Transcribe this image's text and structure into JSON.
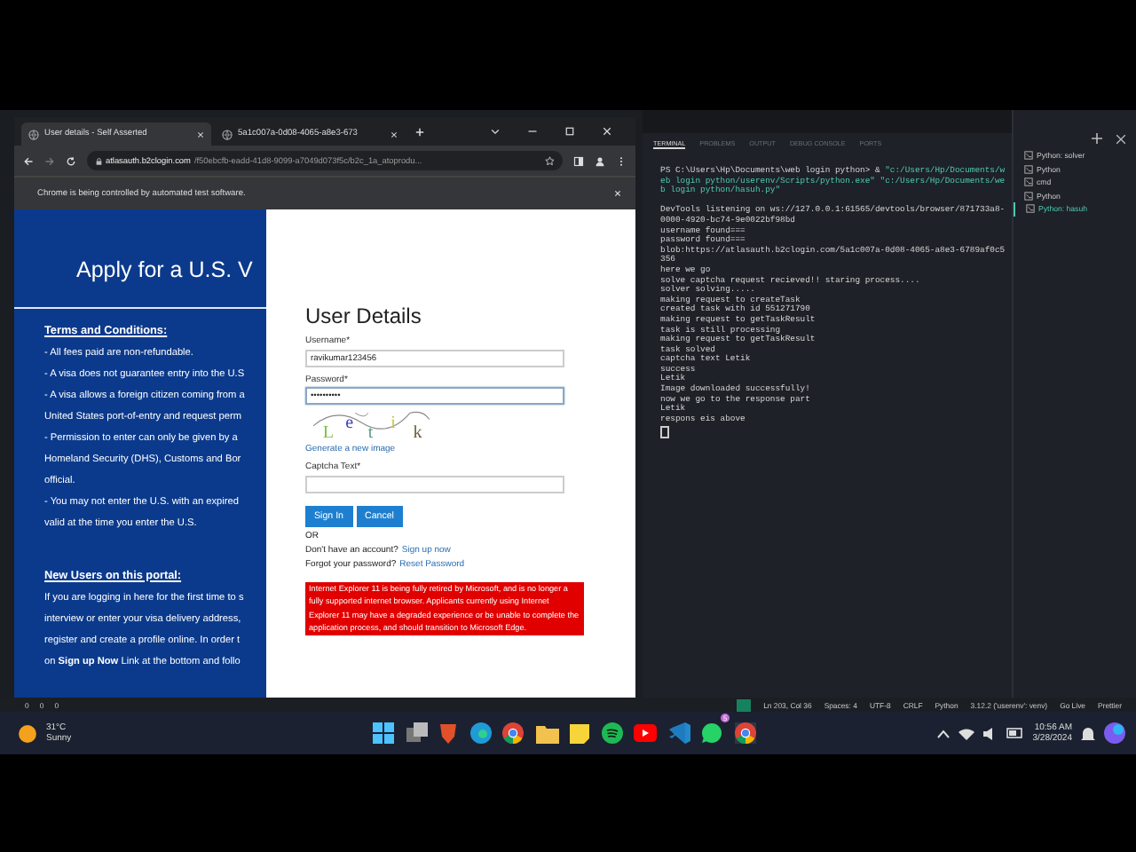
{
  "browser": {
    "tabs": [
      {
        "title": "User details - Self Asserted",
        "selected": true
      },
      {
        "title": "5a1c007a-0d08-4065-a8e3-673",
        "selected": false
      }
    ],
    "url_host": "atlasauth.b2clogin.com",
    "url_path": "/f50ebcfb-eadd-41d8-9099-a7049d073f5c/b2c_1a_atoprodu...",
    "infobar": "Chrome is being controlled by automated test software."
  },
  "page": {
    "banner_title": "Apply for a U.S. V",
    "terms_heading": "Terms and Conditions:",
    "terms_lines": [
      "- All fees paid are non-refundable.",
      "- A visa does not guarantee entry into the U.S",
      "- A visa allows a foreign citizen coming from a",
      "United States port-of-entry and request perm",
      "- Permission to enter can only be given by a",
      "Homeland Security (DHS), Customs and Bor",
      "official.",
      "- You may not enter the U.S. with an expired",
      "valid at the time you enter the U.S."
    ],
    "new_users_heading": "New Users on this portal:",
    "new_users_lines": [
      "If you are logging in here for the first time to s",
      "interview or enter your visa delivery address,",
      "register and create a profile online. In order t",
      "on **Sign up Now** Link at the bottom and follo"
    ]
  },
  "login": {
    "title": "User Details",
    "username_label": "Username*",
    "username_value": "ravikumar123456",
    "password_label": "Password*",
    "password_value": "••••••••••",
    "captcha_letters": [
      "L",
      "e",
      "t",
      "i",
      "k"
    ],
    "generate_link": "Generate a new image",
    "captcha_label": "Captcha Text*",
    "buttons": [
      "Sign In",
      "Cancel"
    ],
    "or": "OR",
    "signup_prompt": "Don't have an account?",
    "signup_link": "Sign up now",
    "forgot_prompt": "Forgot your password?",
    "reset_link": "Reset Password",
    "warning": "Internet Explorer 11 is being fully retired by Microsoft, and is no longer a fully supported internet browser. Applicants currently using Internet Explorer 11 may have a degraded experience or be unable to complete the application process, and should transition to Microsoft Edge."
  },
  "terminal": {
    "tabs": [
      {
        "label": "TERMINAL",
        "selected": true
      },
      {
        "label": "PROBLEMS",
        "selected": false
      },
      {
        "label": "OUTPUT",
        "selected": false
      },
      {
        "label": "DEBUG CONSOLE",
        "selected": false
      },
      {
        "label": "PORTS",
        "selected": false
      }
    ],
    "prompt": "PS C:\\Users\\Hp\\Documents\\web login python> & ",
    "command": "\"c:/Users/Hp/Documents/web login python/userenv/Scripts/python.exe\" \"c:/Users/Hp/Documents/web login python/hasuh.py\"",
    "lines": [
      "DevTools listening on ws://127.0.0.1:61565/devtools/browser/871733a8-0000-4920-bc74-9e0022bf98bd",
      "username found===",
      "password found===",
      "blob:https://atlasauth.b2clogin.com/5a1c007a-0d08-4065-a8e3-6789af0c5356",
      "here we go",
      "solve captcha request recieved!! staring process....",
      "solver solving.....",
      "making request to createTask",
      "created task with id 551271790",
      "making request to getTaskResult",
      "task is still processing",
      "making request to getTaskResult",
      "task solved",
      "captcha text  Letik",
      "success",
      "Letik",
      "Image downloaded successfully!",
      "now we go to the response part",
      "Letik",
      "respons eis above"
    ]
  },
  "terminal_list": [
    {
      "label": "Python: solver",
      "selected": false
    },
    {
      "label": "Python",
      "selected": false
    },
    {
      "label": "cmd",
      "selected": false
    },
    {
      "label": "Python",
      "selected": false
    },
    {
      "label": "Python: hasuh",
      "selected": true
    }
  ],
  "status_bar": {
    "counts": [
      "0",
      "0",
      "0"
    ],
    "items": [
      "Ln 203, Col 36",
      "Spaces: 4",
      "UTF-8",
      "CRLF",
      "Python",
      "3.12.2 ('userenv': venv)",
      "Go Live",
      "Prettier"
    ]
  },
  "taskbar": {
    "temperature": "31°C",
    "weather": "Sunny",
    "whatsapp_badge": "5",
    "time": "10:56 AM",
    "date": "3/28/2024"
  }
}
